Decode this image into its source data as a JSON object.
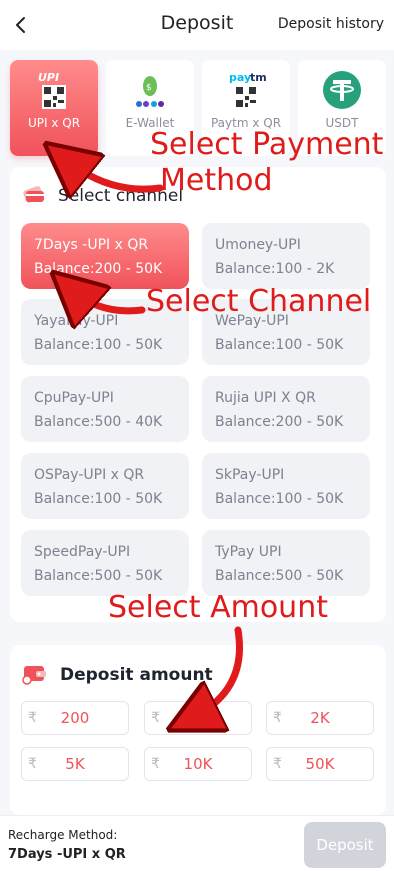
{
  "header": {
    "title": "Deposit",
    "history_label": "Deposit history"
  },
  "methods": [
    {
      "label": "UPI x QR",
      "icon": "upi-qr-icon"
    },
    {
      "label": "E-Wallet",
      "icon": "e-wallet-icon"
    },
    {
      "label": "Paytm x QR",
      "icon": "paytm-qr-icon"
    },
    {
      "label": "USDT",
      "icon": "usdt-icon"
    }
  ],
  "channel_section": {
    "title": "Select channel"
  },
  "channels": [
    {
      "name": "7Days -UPI x QR",
      "balance": "Balance:200 - 50K"
    },
    {
      "name": "Umoney-UPI",
      "balance": "Balance:100 - 2K"
    },
    {
      "name": "YayaPay-UPI",
      "balance": "Balance:100 - 50K"
    },
    {
      "name": "WePay-UPI",
      "balance": "Balance:100 - 50K"
    },
    {
      "name": "CpuPay-UPI",
      "balance": "Balance:500 - 40K"
    },
    {
      "name": "Rujia UPI X QR",
      "balance": "Balance:200 - 50K"
    },
    {
      "name": "OSPay-UPI x QR",
      "balance": "Balance:100 - 50K"
    },
    {
      "name": "SkPay-UPI",
      "balance": "Balance:100 - 50K"
    },
    {
      "name": "SpeedPay-UPI",
      "balance": "Balance:500 - 50K"
    },
    {
      "name": "TyPay UPI",
      "balance": "Balance:500 - 50K"
    }
  ],
  "amount_section": {
    "title": "Deposit amount",
    "currency": "₹"
  },
  "amounts": [
    "200",
    "1K",
    "2K",
    "5K",
    "10K",
    "50K"
  ],
  "footer": {
    "method_label": "Recharge Method:",
    "method_value": "7Days -UPI x QR",
    "deposit_label": "Deposit"
  },
  "annotations": {
    "payment": [
      "Select Payment",
      "Method"
    ],
    "channel": "Select Channel",
    "amount": "Select Amount"
  },
  "colors": {
    "accent": "#f0525a",
    "annotation": "#e01b1b",
    "usdt": "#26a17b"
  }
}
